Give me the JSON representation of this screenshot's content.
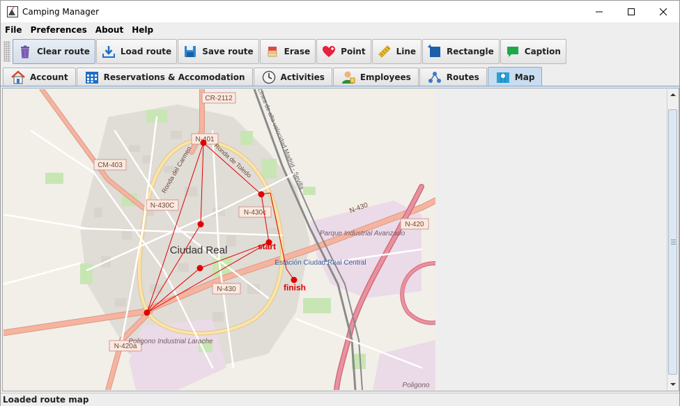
{
  "window": {
    "title": "Camping Manager"
  },
  "menu": [
    {
      "label": "File"
    },
    {
      "label": "Preferences"
    },
    {
      "label": "About"
    },
    {
      "label": "Help"
    }
  ],
  "toolbar": {
    "clear_route": "Clear route",
    "load_route": "Load route",
    "save_route": "Save route",
    "erase": "Erase",
    "point": "Point",
    "line": "Line",
    "rectangle": "Rectangle",
    "caption": "Caption"
  },
  "tabs": {
    "account": "Account",
    "reservations": "Reservations & Accomodation",
    "activities": "Activities",
    "employees": "Employees",
    "routes": "Routes",
    "map": "Map",
    "active": "Map"
  },
  "map": {
    "city": "Ciudad Real",
    "roads": [
      "CR-2112",
      "N-401",
      "CM-403",
      "N-430C",
      "N-430c",
      "N-430",
      "N-420",
      "N-420a"
    ],
    "street_labels": [
      "Ronda del Carmen",
      "Ronda de Toledo",
      "Línea de alta velocidad Madrid - Sevilla"
    ],
    "place_labels": [
      "Parque Industrial Avanzado",
      "Estación Ciudad Real Central",
      "Poligono Industrial Larache",
      "Poligono"
    ],
    "route_captions": {
      "start": "start",
      "finish": "finish"
    },
    "route_color": "#e00000"
  },
  "status": {
    "text": "Loaded route map"
  }
}
